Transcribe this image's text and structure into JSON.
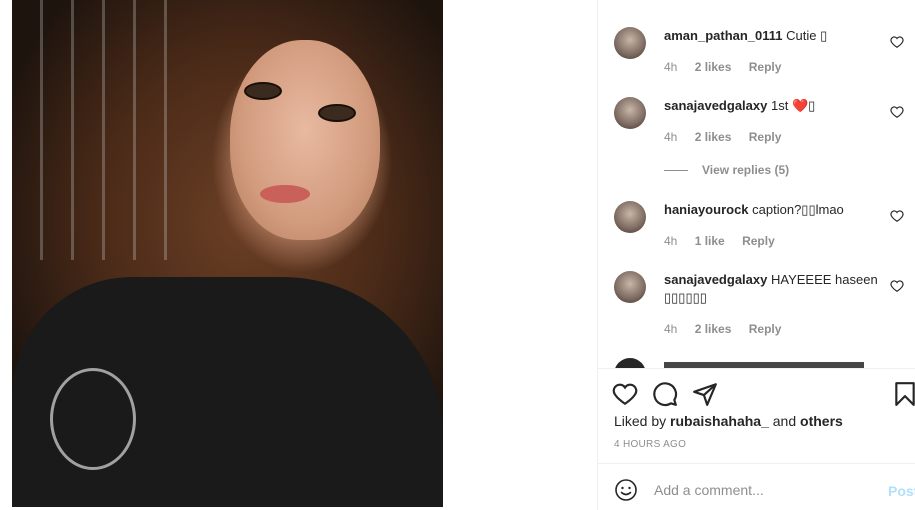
{
  "comments": [
    {
      "user": "aman_pathan_0111",
      "text": "Cutie ▯",
      "time": "4h",
      "likes": "2 likes",
      "reply": "Reply"
    },
    {
      "user": "sanajavedgalaxy",
      "text": "1st ❤️▯",
      "time": "4h",
      "likes": "2 likes",
      "reply": "Reply",
      "view_replies": "View replies (5)"
    },
    {
      "user": "haniayourock",
      "text": "caption?▯▯lmao",
      "time": "4h",
      "likes": "1 like",
      "reply": "Reply"
    },
    {
      "user": "sanajavedgalaxy",
      "text": "HAYEEEE haseen ▯▯▯▯▯▯",
      "time": "4h",
      "likes": "2 likes",
      "reply": "Reply"
    }
  ],
  "post": {
    "liked_by_prefix": "Liked by",
    "liked_by_user": "rubaishahaha_",
    "liked_by_and": "and",
    "liked_by_others": "others",
    "time_ago": "4 HOURS AGO"
  },
  "add_comment": {
    "placeholder": "Add a comment...",
    "post_label": "Post"
  },
  "icons": {
    "like": "heart-icon",
    "comment": "comment-icon",
    "share": "paper-plane-icon",
    "save": "bookmark-icon",
    "emoji": "emoji-icon"
  },
  "colors": {
    "text": "#262626",
    "muted": "#8e8e8e",
    "post_disabled": "#b2dffc",
    "border": "#efefef"
  }
}
